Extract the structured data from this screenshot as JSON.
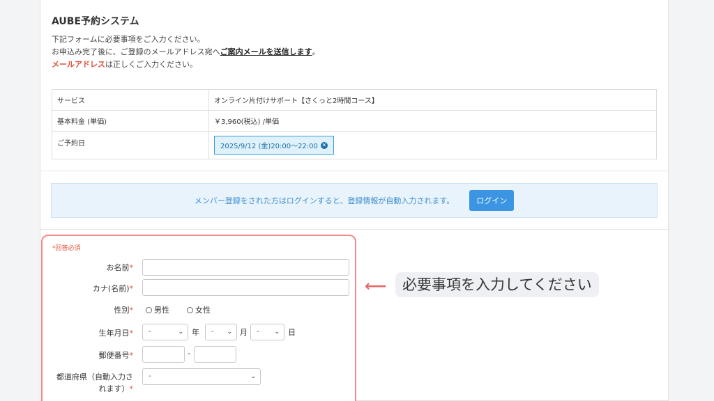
{
  "header": {
    "title": "AUBE予約システム",
    "line1": "下記フォームに必要事項をご入力ください。",
    "line2_pre": "お申込み完了後に、ご登録のメールアドレス宛へ",
    "line2_em": "ご案内メールを送信します",
    "line2_post": "。",
    "line3_red": "メールアドレス",
    "line3_post": "は正しくご入力ください。"
  },
  "info_table": {
    "service_label": "サービス",
    "service_value": "オンライン片付けサポート【さくっと2時間コース】",
    "price_label": "基本料金 (単価)",
    "price_value": "￥3,960(税込) /単価",
    "date_label": "ご予約日",
    "date_value": "2025/9/12 (金)20:00〜22:00"
  },
  "login_bar": {
    "message": "メンバー登録をされた方はログインすると、登録情報が自動入力されます。",
    "button": "ログイン"
  },
  "form": {
    "required_note": "*回答必須",
    "name_label": "お名前",
    "kana_label": "カナ(名前)",
    "gender_label": "性別",
    "gender_male": "男性",
    "gender_female": "女性",
    "birth_label": "生年月日",
    "birth_year_value": "-",
    "birth_year_unit": "年",
    "birth_month_value": "-",
    "birth_month_unit": "月",
    "birth_day_value": "-",
    "birth_day_unit": "日",
    "postal_label": "郵便番号",
    "postal_sep": "-",
    "pref_label_1": "都道府県（自動入力さ",
    "pref_label_2": "れます）",
    "pref_value": "-",
    "asterisk": "*"
  },
  "annotation": {
    "arrow": "⟵",
    "callout": "必要事項を入力してください"
  },
  "colors": {
    "accent_red": "#e2503a",
    "form_border": "#f08a8a",
    "login_button": "#3b95e3"
  }
}
